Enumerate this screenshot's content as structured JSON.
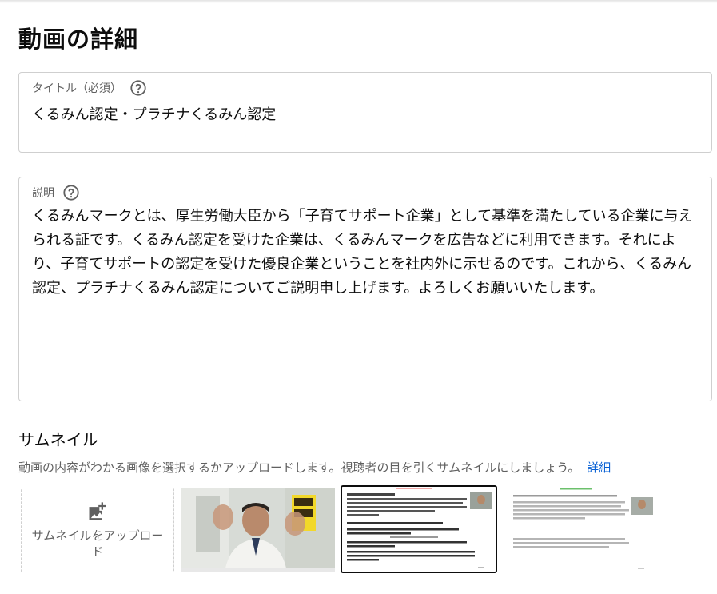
{
  "page": {
    "title": "動画の詳細"
  },
  "title_field": {
    "label": "タイトル（必須）",
    "value": "くるみん認定・プラチナくるみん認定",
    "help_icon": "help-circle-icon"
  },
  "description_field": {
    "label": "説明",
    "value": "くるみんマークとは、厚生労働大臣から「子育てサポート企業」として基準を満たしている企業に与えられる証です。くるみん認定を受けた企業は、くるみんマークを広告などに利用できます。それにより、子育てサポートの認定を受けた優良企業ということを社内外に示せるのです。これから、くるみん認定、プラチナくるみん認定についてご説明申し上げます。よろしくお願いいたします。",
    "help_icon": "help-circle-icon"
  },
  "thumbnail": {
    "heading": "サムネイル",
    "description": "動画の内容がわかる画像を選択するかアップロードします。視聴者の目を引くサムネイルにしましょう。",
    "learn_more": "詳細",
    "upload_label": "サムネイルをアップロード",
    "upload_icon": "add-photo-icon",
    "options": [
      {
        "kind": "presenter-frame",
        "selected": false
      },
      {
        "kind": "slide-frame",
        "selected": true
      },
      {
        "kind": "slide-frame",
        "selected": false
      }
    ]
  },
  "colors": {
    "link": "#065fd4",
    "border": "#cfcfcf",
    "selected_border": "#0d0d0d",
    "muted_text": "#606060"
  }
}
